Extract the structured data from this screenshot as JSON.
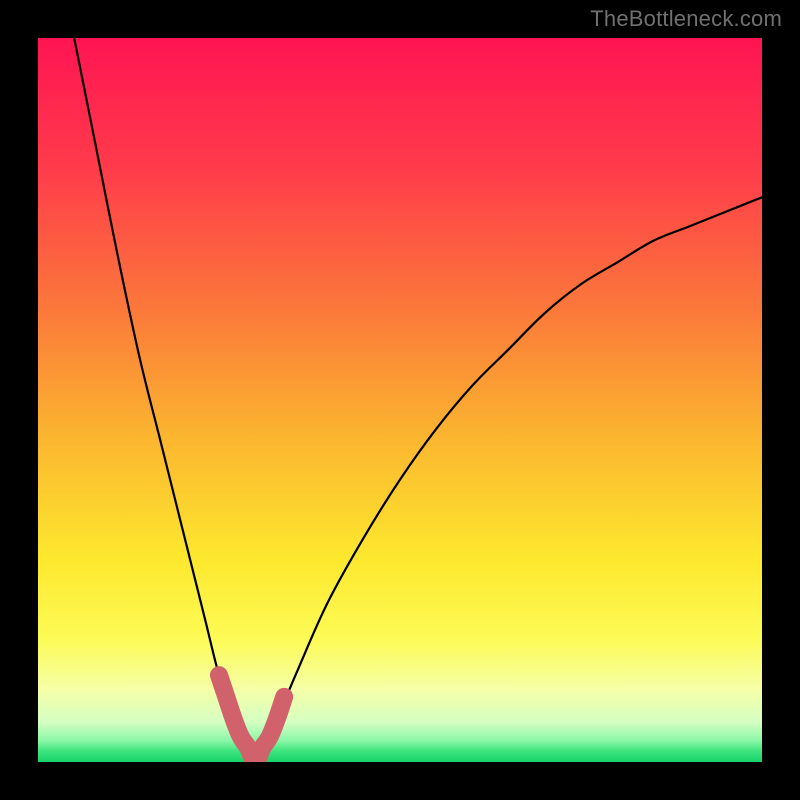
{
  "watermark": "TheBottleneck.com",
  "chart_data": {
    "type": "line",
    "title": "",
    "xlabel": "",
    "ylabel": "",
    "xlim": [
      0,
      100
    ],
    "ylim": [
      0,
      100
    ],
    "grid": false,
    "legend": false,
    "series": [
      {
        "name": "curve",
        "color": "#000000",
        "x": [
          5,
          8,
          11,
          14,
          17,
          20,
          23,
          25,
          27,
          29,
          30,
          31,
          33,
          36,
          40,
          45,
          50,
          55,
          60,
          65,
          70,
          75,
          80,
          85,
          90,
          95,
          100
        ],
        "y": [
          100,
          85,
          70,
          56,
          44,
          32,
          20,
          12,
          6,
          2,
          0,
          2,
          6,
          13,
          22,
          31,
          39,
          46,
          52,
          57,
          62,
          66,
          69,
          72,
          74,
          76,
          78
        ]
      },
      {
        "name": "highlight-band",
        "color": "#d1626b",
        "x": [
          25,
          26,
          27,
          28,
          29,
          30,
          31,
          32,
          33,
          34
        ],
        "y": [
          12,
          9,
          6,
          3.5,
          2,
          0,
          2,
          3.5,
          6,
          9
        ]
      }
    ],
    "background_gradient_stops": [
      {
        "offset": 0.0,
        "color": "#ff1452"
      },
      {
        "offset": 0.18,
        "color": "#ff3b4b"
      },
      {
        "offset": 0.38,
        "color": "#fb7a3a"
      },
      {
        "offset": 0.55,
        "color": "#fbb52f"
      },
      {
        "offset": 0.72,
        "color": "#fde82e"
      },
      {
        "offset": 0.83,
        "color": "#fdfb56"
      },
      {
        "offset": 0.9,
        "color": "#f5ffa7"
      },
      {
        "offset": 0.945,
        "color": "#d4ffc2"
      },
      {
        "offset": 0.97,
        "color": "#8cf7a8"
      },
      {
        "offset": 0.985,
        "color": "#3de47e"
      },
      {
        "offset": 1.0,
        "color": "#17d36a"
      }
    ]
  }
}
